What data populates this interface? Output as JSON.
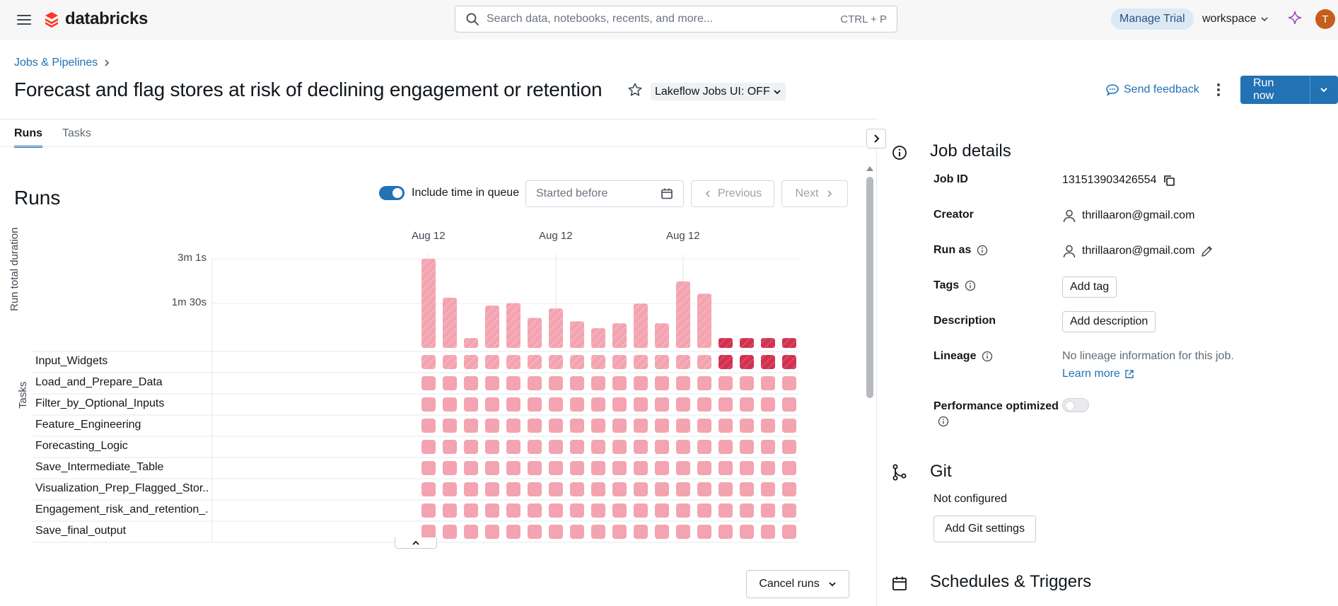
{
  "topbar": {
    "brand": "databricks",
    "search_placeholder": "Search data, notebooks, recents, and more...",
    "search_shortcut": "CTRL + P",
    "manage_trial": "Manage Trial",
    "workspace": "workspace",
    "avatar_initial": "T"
  },
  "header": {
    "breadcrumb": "Jobs & Pipelines",
    "title": "Forecast and flag stores at risk of declining engagement or retention",
    "lakeflow_toggle": "Lakeflow Jobs UI: OFF",
    "send_feedback": "Send feedback",
    "run_now": "Run now"
  },
  "tabs": [
    {
      "label": "Runs",
      "active": true
    },
    {
      "label": "Tasks",
      "active": false
    }
  ],
  "runs": {
    "heading": "Runs",
    "include_time_in_queue": "Include time in queue",
    "include_time_in_queue_on": true,
    "started_before_placeholder": "Started before",
    "previous": "Previous",
    "next": "Next",
    "cancel_runs": "Cancel runs"
  },
  "chart_data": {
    "type": "bar",
    "ylabel": "Run total duration",
    "y_ticks": [
      "3m 1s",
      "1m 30s"
    ],
    "y_tick_seconds": [
      181,
      90
    ],
    "date_labels": [
      "Aug 12",
      "Aug 12",
      "Aug 12"
    ],
    "runs_duration_seconds": [
      181,
      102,
      20,
      86,
      91,
      61,
      80,
      54,
      40,
      50,
      90,
      50,
      135,
      110,
      20,
      20,
      20,
      20
    ],
    "run_status": [
      "success",
      "success",
      "success",
      "success",
      "success",
      "success",
      "success",
      "success",
      "success",
      "success",
      "success",
      "success",
      "success",
      "success",
      "failed",
      "failed",
      "failed",
      "failed"
    ],
    "tasks_label": "Tasks",
    "tasks": [
      "Input_Widgets",
      "Load_and_Prepare_Data",
      "Filter_by_Optional_Inputs",
      "Feature_Engineering",
      "Forecasting_Logic",
      "Save_Intermediate_Table",
      "Visualization_Prep_Flagged_Stor...",
      "Engagement_risk_and_retention_...",
      "Save_final_output"
    ],
    "colors": {
      "success": "#f4a3b0",
      "failed": "#d2314f"
    }
  },
  "job_details": {
    "heading": "Job details",
    "job_id_label": "Job ID",
    "job_id": "131513903426554",
    "creator_label": "Creator",
    "creator": "thrillaaron@gmail.com",
    "run_as_label": "Run as",
    "run_as": "thrillaaron@gmail.com",
    "tags_label": "Tags",
    "add_tag": "Add tag",
    "description_label": "Description",
    "add_description": "Add description",
    "lineage_label": "Lineage",
    "lineage_text": "No lineage information for this job.",
    "learn_more": "Learn more",
    "performance_label": "Performance optimized",
    "performance_on": false
  },
  "git": {
    "heading": "Git",
    "status": "Not configured",
    "add_button": "Add Git settings"
  },
  "schedules": {
    "heading": "Schedules & Triggers"
  }
}
